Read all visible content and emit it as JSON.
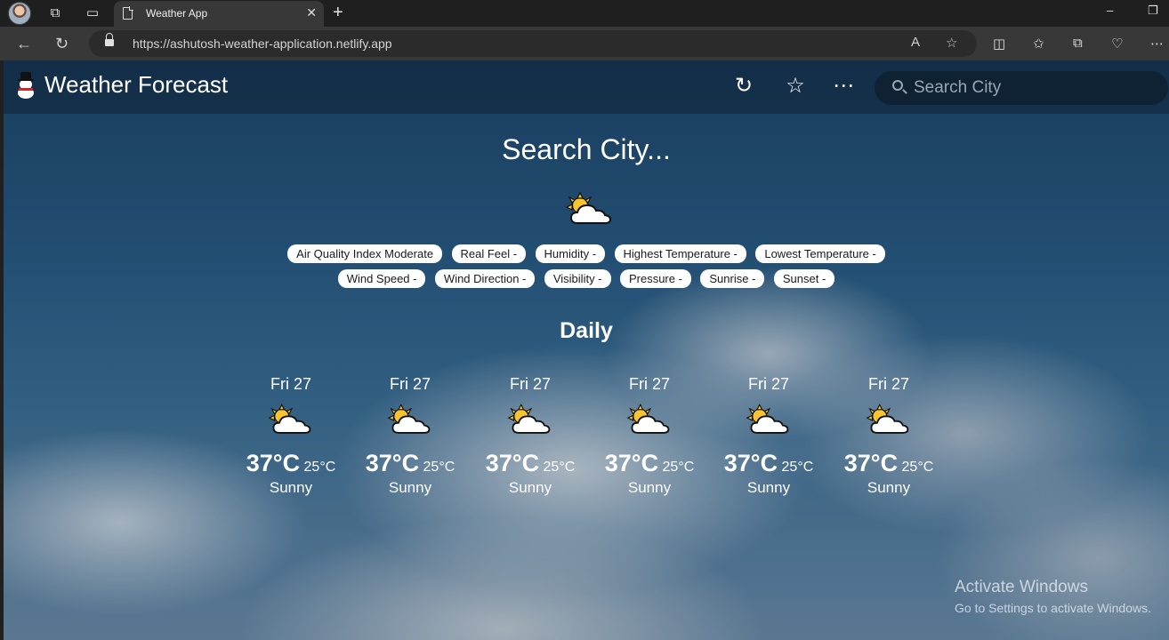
{
  "browser": {
    "tab_title": "Weather App",
    "tab_close": "✕",
    "new_tab": "+",
    "url": "https://ashutosh-weather-application.netlify.app",
    "minimize": "–",
    "restore": "❐"
  },
  "header": {
    "app_title": "Weather Forecast",
    "search_placeholder": "Search City"
  },
  "main": {
    "heading": "Search City...",
    "chips_row1": [
      "Air Quality Index Moderate",
      "Real Feel -",
      "Humidity -",
      "Highest Temperature -",
      "Lowest Temperature -"
    ],
    "chips_row2": [
      "Wind Speed -",
      "Wind Direction -",
      "Visibility -",
      "Pressure -",
      "Sunrise -",
      "Sunset -"
    ],
    "daily_title": "Daily",
    "forecast": [
      {
        "date": "Fri 27",
        "high": "37°C",
        "low": "25°C",
        "condition": "Sunny",
        "icon": "partly-sunny-icon"
      },
      {
        "date": "Fri 27",
        "high": "37°C",
        "low": "25°C",
        "condition": "Sunny",
        "icon": "partly-sunny-icon"
      },
      {
        "date": "Fri 27",
        "high": "37°C",
        "low": "25°C",
        "condition": "Sunny",
        "icon": "partly-sunny-icon"
      },
      {
        "date": "Fri 27",
        "high": "37°C",
        "low": "25°C",
        "condition": "Sunny",
        "icon": "partly-sunny-icon"
      },
      {
        "date": "Fri 27",
        "high": "37°C",
        "low": "25°C",
        "condition": "Sunny",
        "icon": "partly-sunny-icon"
      },
      {
        "date": "Fri 27",
        "high": "37°C",
        "low": "25°C",
        "condition": "Sunny",
        "icon": "partly-sunny-icon"
      }
    ]
  },
  "watermark": {
    "line1": "Activate Windows",
    "line2": "Go to Settings to activate Windows."
  }
}
